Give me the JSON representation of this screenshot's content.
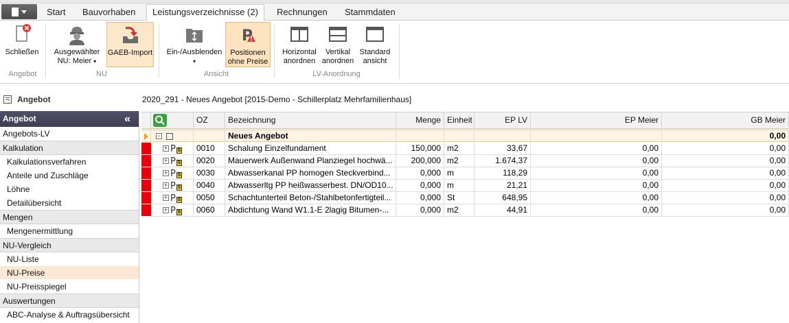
{
  "tabs": [
    {
      "label": "Start"
    },
    {
      "label": "Bauvorhaben"
    },
    {
      "label": "Leistungsverzeichnisse (2)"
    },
    {
      "label": "Rechnungen"
    },
    {
      "label": "Stammdaten"
    }
  ],
  "ribbon": {
    "close_label": "Schließen",
    "group_angebot": "Angebot",
    "nu_select_line1": "Ausgewählter",
    "nu_select_line2": "NU: Meier",
    "gaeb_import": "GAEB-Import",
    "group_nu": "NU",
    "toggle_label": "Ein-/Ausblenden",
    "positions_line1": "Positionen",
    "positions_line2": "ohne Preise",
    "group_ansicht": "Ansicht",
    "horizontal_line1": "Horizontal",
    "horizontal_line2": "anordnen",
    "vertical_line1": "Vertikal",
    "vertical_line2": "anordnen",
    "standard_line1": "Standard",
    "standard_line2": "ansicht",
    "group_lv": "LV-Anordnung"
  },
  "header": {
    "section": "Angebot",
    "title": "2020_291 - Neues Angebot [2015-Demo - Schillerplatz Mehrfamilienhaus]"
  },
  "sidebar": {
    "title": "Angebot",
    "collapse_glyph": "«",
    "items": [
      {
        "label": "Angebots-LV",
        "kind": "top"
      },
      {
        "label": "Kalkulation",
        "kind": "group"
      },
      {
        "label": "Kalkulationsverfahren",
        "kind": "item"
      },
      {
        "label": "Anteile und Zuschläge",
        "kind": "item"
      },
      {
        "label": "Löhne",
        "kind": "item"
      },
      {
        "label": "Detailübersicht",
        "kind": "item"
      },
      {
        "label": "Mengen",
        "kind": "group"
      },
      {
        "label": "Mengenermittlung",
        "kind": "item"
      },
      {
        "label": "NU-Vergleich",
        "kind": "group"
      },
      {
        "label": "NU-Liste",
        "kind": "item"
      },
      {
        "label": "NU-Preise",
        "kind": "item",
        "selected": true
      },
      {
        "label": "NU-Preisspiegel",
        "kind": "item"
      },
      {
        "label": "Auswertungen",
        "kind": "group"
      },
      {
        "label": "ABC-Analyse & Auftragsübersicht",
        "kind": "item"
      }
    ]
  },
  "grid": {
    "columns": {
      "oz": "OZ",
      "bezeichnung": "Bezeichnung",
      "menge": "Menge",
      "einheit": "Einheit",
      "ep_lv": "EP LV",
      "ep_meier": "EP Meier",
      "gb_meier": "GB Meier"
    },
    "group_row": {
      "label": "Neues Angebot",
      "gb_meier": "0,00"
    },
    "rows": [
      {
        "oz": "0010",
        "bezeichnung": "Schalung Einzelfundament",
        "menge": "150,000",
        "einheit": "m2",
        "ep_lv": "33,67",
        "ep_meier": "0,00",
        "gb_meier": "0,00"
      },
      {
        "oz": "0020",
        "bezeichnung": "Mauerwerk Außenwand Planziegel hochwä...",
        "menge": "200,000",
        "einheit": "m2",
        "ep_lv": "1.674,37",
        "ep_meier": "0,00",
        "gb_meier": "0,00"
      },
      {
        "oz": "0030",
        "bezeichnung": "Abwasserkanal PP homogen Steckverbind...",
        "menge": "0,000",
        "einheit": "m",
        "ep_lv": "118,29",
        "ep_meier": "0,00",
        "gb_meier": "0,00"
      },
      {
        "oz": "0040",
        "bezeichnung": "Abwasserltg PP heißwasserbest. DN/OD10...",
        "menge": "0,000",
        "einheit": "m",
        "ep_lv": "21,21",
        "ep_meier": "0,00",
        "gb_meier": "0,00"
      },
      {
        "oz": "0050",
        "bezeichnung": "Schachtunterteil Beton-/Stahlbetonfertigteil...",
        "menge": "0,000",
        "einheit": "St",
        "ep_lv": "648,95",
        "ep_meier": "0,00",
        "gb_meier": "0,00"
      },
      {
        "oz": "0060",
        "bezeichnung": "Abdichtung Wand W1.1-E 2lagig Bitumen-...",
        "menge": "0,000",
        "einheit": "m2",
        "ep_lv": "44,91",
        "ep_meier": "0,00",
        "gb_meier": "0,00"
      }
    ]
  },
  "colors": {
    "accent": "#4f4f66",
    "highlight": "#fce7cb",
    "marker": "#e8000b",
    "search_green": "#3ea043"
  }
}
